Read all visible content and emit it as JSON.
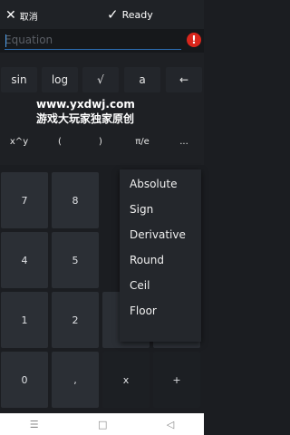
{
  "topbar": {
    "cancel_label": "取消",
    "ready_label": "Ready"
  },
  "equation": {
    "placeholder": "Equation",
    "value": ""
  },
  "error_icon_label": "!",
  "functions": [
    {
      "label": "sin"
    },
    {
      "label": "log"
    },
    {
      "label": "√"
    },
    {
      "label": "a"
    },
    {
      "label": "←"
    },
    {
      "label": "x^y"
    },
    {
      "label": "("
    },
    {
      "label": ")"
    },
    {
      "label": "π/e"
    },
    {
      "label": "..."
    }
  ],
  "watermark": {
    "line1": "www.yxdwj.com",
    "line2": "游戏大玩家独家原创"
  },
  "keys": [
    {
      "label": "7"
    },
    {
      "label": "8"
    },
    {
      "label": "4"
    },
    {
      "label": "5"
    },
    {
      "label": "1"
    },
    {
      "label": "2"
    },
    {
      "label": "0"
    },
    {
      "label": ","
    },
    {
      "label": "x"
    },
    {
      "label": "+"
    }
  ],
  "menu": {
    "items": [
      {
        "label": "Absolute"
      },
      {
        "label": "Sign"
      },
      {
        "label": "Derivative"
      },
      {
        "label": "Round"
      },
      {
        "label": "Ceil"
      },
      {
        "label": "Floor"
      }
    ]
  },
  "navbar": {
    "menu_icon": "☰",
    "home_icon": "□",
    "back_icon": "◁"
  }
}
